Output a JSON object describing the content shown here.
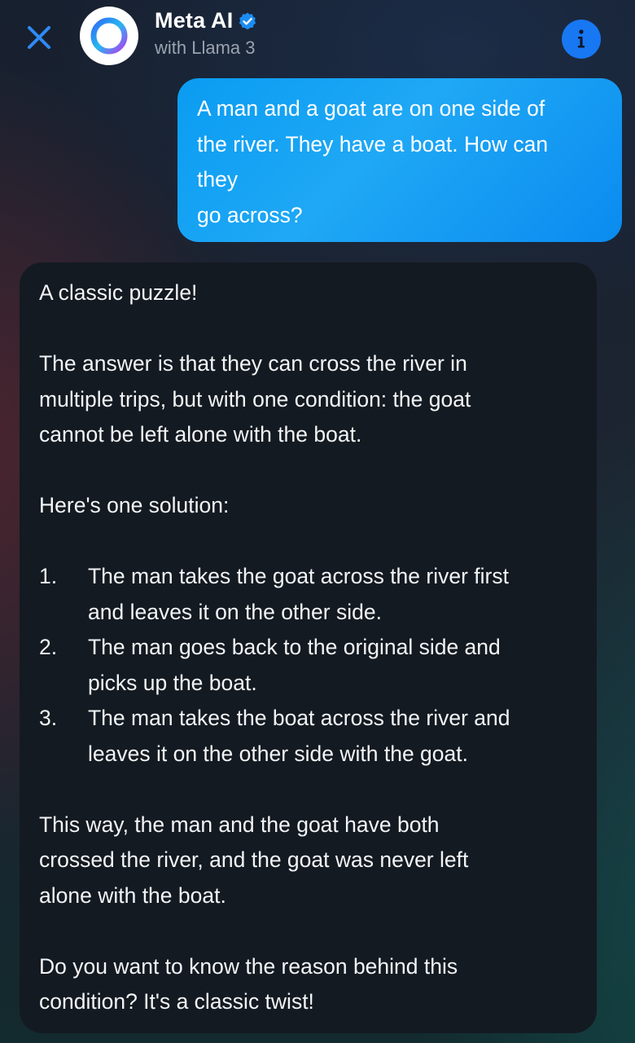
{
  "header": {
    "title": "Meta AI",
    "subtitle": "with Llama 3",
    "icons": {
      "close": "close-icon",
      "avatar": "meta-ai-ring-icon",
      "verified": "verified-badge-icon",
      "info": "info-icon"
    }
  },
  "user_message": {
    "lines": [
      "A man and a goat are on one side of",
      "the river. They have a boat. How can",
      "they",
      "go across?"
    ]
  },
  "ai_message": {
    "intro": "A classic puzzle!",
    "paragraph1": [
      "The answer is that they can cross the river in",
      "multiple trips, but with one condition: the goat",
      "cannot be left alone with the boat."
    ],
    "solution_heading": "Here's one solution:",
    "steps": [
      {
        "number": "1.",
        "lines": [
          "The man takes the goat across the river first",
          "and leaves it on the other side."
        ]
      },
      {
        "number": "2.",
        "lines": [
          "The man goes back to the original side and",
          "picks up the boat."
        ]
      },
      {
        "number": "3.",
        "lines": [
          "The man takes the boat across the river and",
          "leaves it on the other side with the goat."
        ]
      }
    ],
    "paragraph2": [
      "This way, the man and the goat have both",
      "crossed the river, and the goat was never left",
      "alone with the boat."
    ],
    "paragraph3": [
      "Do you want to know the reason behind this",
      "condition? It's a classic twist!"
    ]
  },
  "colors": {
    "accent_blue": "#1877f2",
    "user_bubble": "#0a9cf2",
    "ai_bubble": "#141a21",
    "subtitle_gray": "#9aa3ae"
  }
}
